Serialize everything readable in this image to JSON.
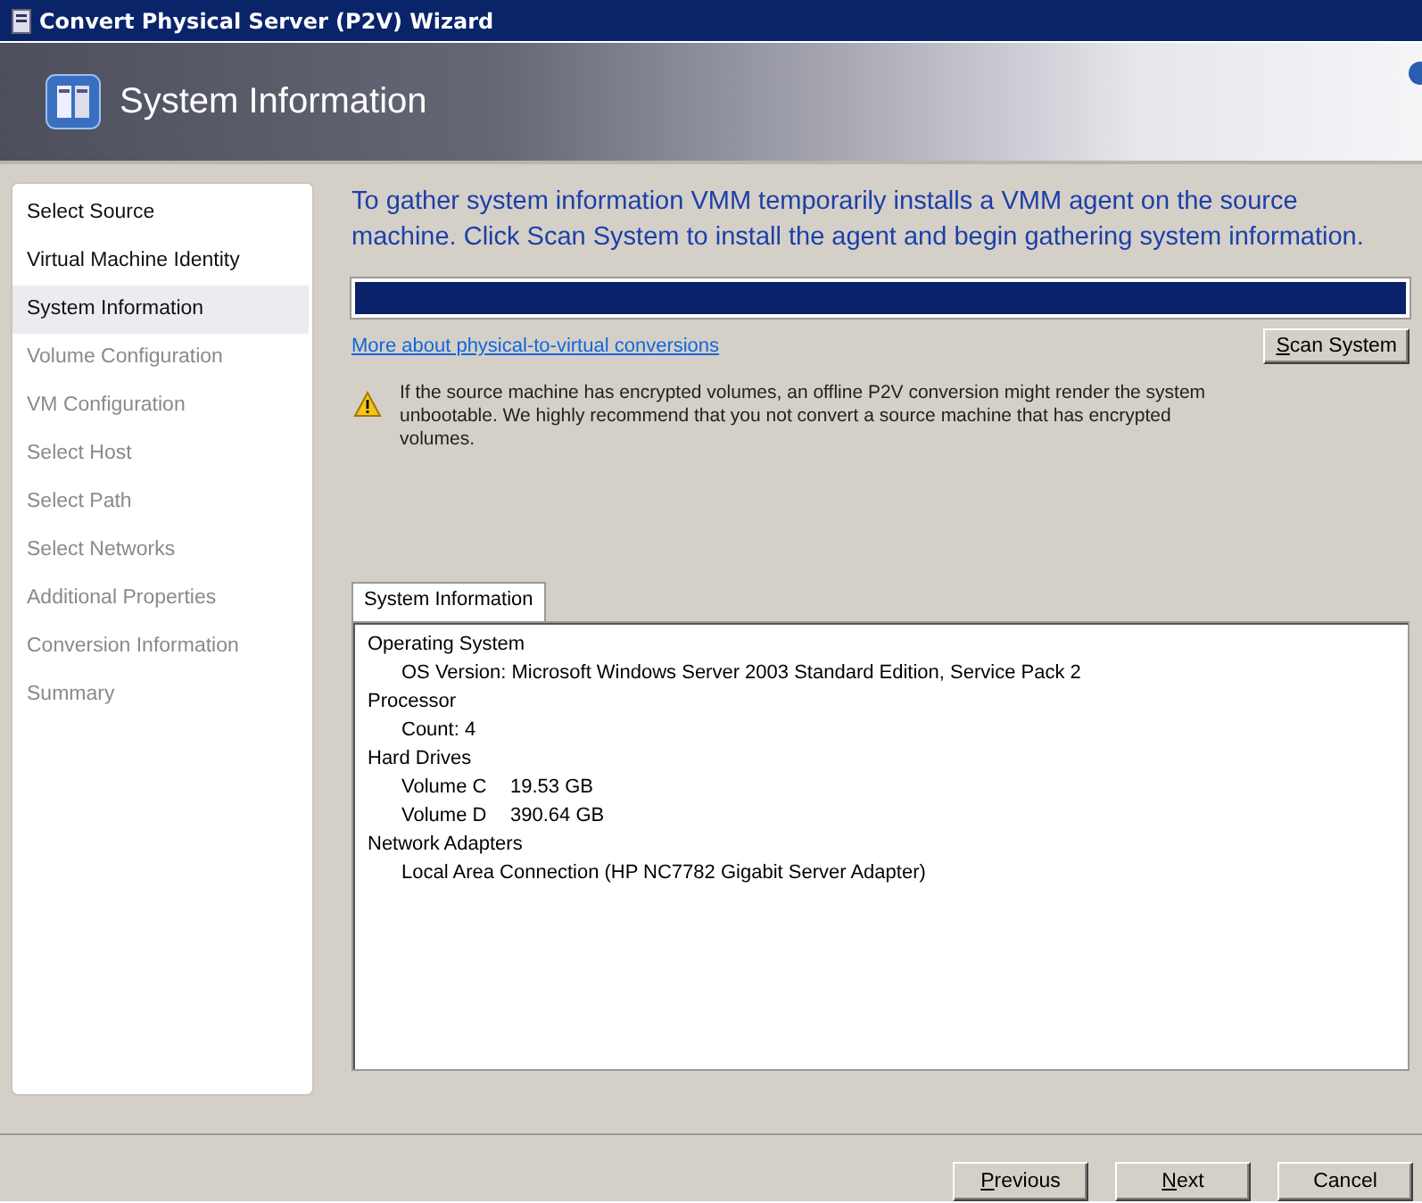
{
  "window": {
    "title": "Convert Physical Server (P2V) Wizard"
  },
  "header": {
    "title": "System Information"
  },
  "steps": [
    {
      "label": "Select Source",
      "selected": false,
      "disabled": false
    },
    {
      "label": "Virtual Machine Identity",
      "selected": false,
      "disabled": false
    },
    {
      "label": "System Information",
      "selected": true,
      "disabled": false
    },
    {
      "label": "Volume Configuration",
      "selected": false,
      "disabled": true
    },
    {
      "label": "VM Configuration",
      "selected": false,
      "disabled": true
    },
    {
      "label": "Select Host",
      "selected": false,
      "disabled": true
    },
    {
      "label": "Select Path",
      "selected": false,
      "disabled": true
    },
    {
      "label": "Select Networks",
      "selected": false,
      "disabled": true
    },
    {
      "label": "Additional Properties",
      "selected": false,
      "disabled": true
    },
    {
      "label": "Conversion Information",
      "selected": false,
      "disabled": true
    },
    {
      "label": "Summary",
      "selected": false,
      "disabled": true
    }
  ],
  "intro": "To gather system information VMM temporarily installs a VMM agent on the source machine. Click Scan System to install the agent and begin gathering system information.",
  "progress": {
    "level": 1
  },
  "link": "More about physical-to-virtual conversions",
  "scan_button": {
    "label": "Scan System",
    "mnemonic": true
  },
  "warning": "If the source machine has encrypted volumes, an offline P2V conversion might render the system unbootable. We highly recommend that you not convert a source machine that has encrypted volumes.",
  "info_tab": {
    "label": "System Information",
    "selected": true
  },
  "tree": [
    {
      "label": "Operating System",
      "children": [
        {
          "label": "OS Version: Microsoft Windows Server 2003 Standard Edition, Service Pack 2"
        }
      ]
    },
    {
      "label": "Processor",
      "children": [
        {
          "label": "Count: 4"
        }
      ]
    },
    {
      "label": "Hard Drives",
      "children": [
        {
          "label": "Volume C",
          "value": "19.53 GB"
        },
        {
          "label": "Volume D",
          "value": "390.64 GB"
        }
      ]
    },
    {
      "label": "Network Adapters",
      "children": [
        {
          "label": "Local Area Connection (HP NC7782 Gigabit Server Adapter)"
        }
      ]
    }
  ],
  "buttons": [
    {
      "label": "Previous",
      "mnemonic": true
    },
    {
      "label": "Next",
      "mnemonic": true
    },
    {
      "label": "Cancel",
      "mnemonic": false
    }
  ]
}
